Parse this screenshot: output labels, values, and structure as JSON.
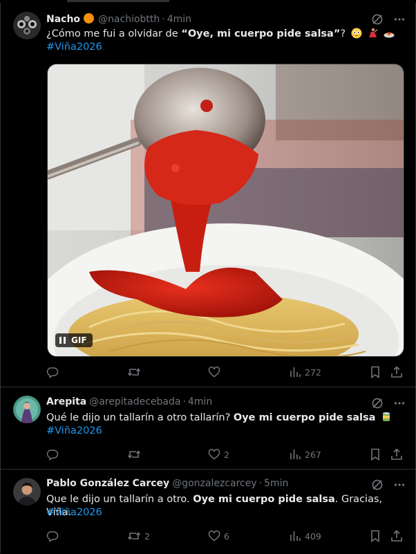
{
  "colors": {
    "background": "#000000",
    "text": "#e7e9ea",
    "muted": "#71767b",
    "link": "#1d9bf0",
    "divider": "#2f3336"
  },
  "tweets": [
    {
      "name": "Nacho",
      "handle": "@nachiobtth",
      "sep": "·",
      "time": "4min",
      "text_before": "¿Cómo me fui a olvidar de ",
      "text_bold": "“Oye, mi cuerpo pide salsa”",
      "text_after": "?",
      "hashtag": "#Viña2026",
      "gif_label": "GIF",
      "replies": "",
      "retweets": "",
      "likes": "",
      "views": "272"
    },
    {
      "name": "Arepita",
      "handle": "@arepitadecebada",
      "sep": "·",
      "time": "4min",
      "text_before": "Qué le dijo un tallarín a otro tallarín? ",
      "text_bold": "Oye mi cuerpo pide salsa",
      "text_after": "",
      "hashtag": "#Viña2026",
      "replies": "",
      "retweets": "",
      "likes": "2",
      "views": "267"
    },
    {
      "name": "Pablo González Carcey",
      "handle": "@gonzalezcarcey",
      "sep": "·",
      "time": "5min",
      "text_before": "Que le dijo un tallarín a otro. ",
      "text_bold": "Oye mi cuerpo pide salsa",
      "text_after": ". Gracias, Viña.",
      "hashtag": "#Viña2026",
      "replies": "",
      "retweets": "2",
      "likes": "6",
      "views": "409"
    }
  ]
}
